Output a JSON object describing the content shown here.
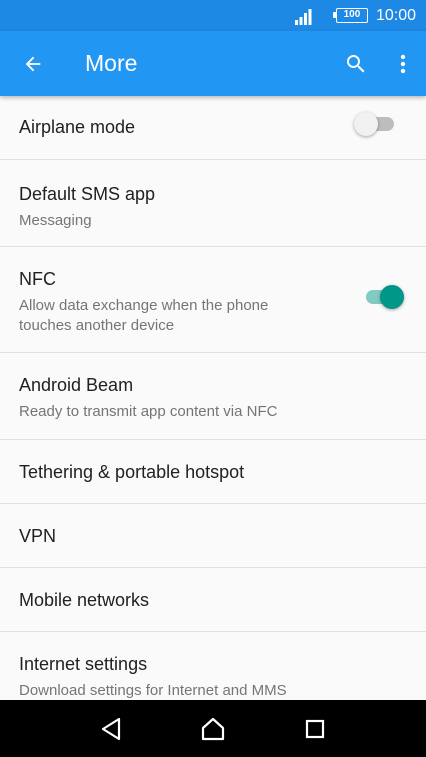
{
  "status_bar": {
    "battery_level": "100",
    "time": "10:00"
  },
  "app_bar": {
    "title": "More",
    "back_icon": "arrow-back-icon",
    "search_icon": "search-icon",
    "overflow_icon": "more-vert-icon"
  },
  "settings": [
    {
      "title": "Airplane mode",
      "switch": "off"
    },
    {
      "title": "Default SMS app",
      "subtitle": "Messaging"
    },
    {
      "title": "NFC",
      "subtitle": "Allow data exchange when the phone touches another device",
      "switch": "on"
    },
    {
      "title": "Android Beam",
      "subtitle": "Ready to transmit app content via NFC"
    },
    {
      "title": "Tethering & portable hotspot"
    },
    {
      "title": "VPN"
    },
    {
      "title": "Mobile networks"
    },
    {
      "title": "Internet settings",
      "subtitle": "Download settings for Internet and MMS"
    }
  ],
  "nav_bar": {
    "back_icon": "nav-back-icon",
    "home_icon": "nav-home-icon",
    "recents_icon": "nav-recents-icon"
  },
  "colors": {
    "status_bar": "#1e88e5",
    "app_bar": "#2196f3",
    "switch_on": "#009688",
    "switch_on_track": "#80cbc4"
  }
}
